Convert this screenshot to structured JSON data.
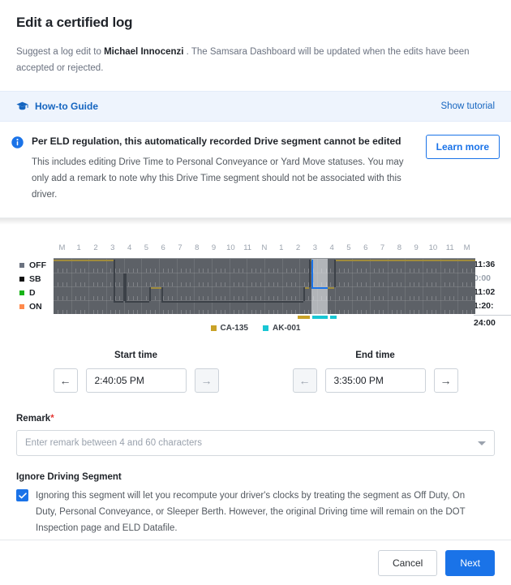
{
  "header": {
    "title": "Edit a certified log",
    "subtitle_pre": "Suggest a log edit to ",
    "driver_name": "Michael Innocenzi",
    "subtitle_post": " . The Samsara Dashboard will be updated when the edits have been accepted or rejected."
  },
  "howto": {
    "icon": "graduation-cap-icon",
    "label": "How-to Guide",
    "tutorial_link": "Show tutorial"
  },
  "notice": {
    "icon": "info-circle-icon",
    "title": "Per ELD regulation, this automatically recorded Drive segment cannot be edited",
    "body": "This includes editing Drive Time to Personal Conveyance or Yard Move statuses. You may only add a remark to note why this Drive Time segment should not be associated with this driver.",
    "learn_more": "Learn more",
    "accent_color": "#1a73e8"
  },
  "chart_data": {
    "type": "line",
    "title": "",
    "xlabel": "",
    "ylabel": "",
    "hour_labels": [
      "M",
      "1",
      "2",
      "3",
      "4",
      "5",
      "6",
      "7",
      "8",
      "9",
      "10",
      "11",
      "N",
      "1",
      "2",
      "3",
      "4",
      "5",
      "6",
      "7",
      "8",
      "9",
      "10",
      "11",
      "M"
    ],
    "statuses": [
      {
        "code": "OFF",
        "color": "#6b7280",
        "total": "11:36"
      },
      {
        "code": "SB",
        "color": "#111111",
        "total": "0:00"
      },
      {
        "code": "D",
        "color": "#17b317",
        "total": "11:02"
      },
      {
        "code": "ON",
        "color": "#ff8a4c",
        "total": "1:20:"
      }
    ],
    "grand_total": "24:00",
    "vehicle_legend": [
      {
        "label": "CA-135",
        "color": "#c9a227"
      },
      {
        "label": "AK-001",
        "color": "#19c6d4"
      }
    ],
    "selected_segment": {
      "start_hour": 14.67,
      "end_hour": 15.58,
      "status": "D",
      "color": "#1a73e8"
    },
    "duty_segments": [
      {
        "status": "OFF",
        "start_hour": 0.0,
        "end_hour": 3.4
      },
      {
        "status": "ON",
        "start_hour": 3.4,
        "end_hour": 3.95
      },
      {
        "status": "SB",
        "start_hour": 3.95,
        "end_hour": 4.05
      },
      {
        "status": "ON",
        "start_hour": 4.05,
        "end_hour": 5.45
      },
      {
        "status": "D",
        "start_hour": 5.45,
        "end_hour": 6.15
      },
      {
        "status": "ON",
        "start_hour": 6.15,
        "end_hour": 14.2
      },
      {
        "status": "D",
        "start_hour": 14.2,
        "end_hour": 14.55
      },
      {
        "status": "OFF",
        "start_hour": 14.55,
        "end_hour": 14.67
      },
      {
        "status": "D",
        "start_hour": 14.67,
        "end_hour": 15.58
      },
      {
        "status": "D",
        "start_hour": 15.58,
        "end_hour": 15.95
      },
      {
        "status": "OFF",
        "start_hour": 15.95,
        "end_hour": 24.0
      }
    ],
    "vehicle_bars": [
      {
        "vehicle": "CA-135",
        "start_hour": 13.9,
        "end_hour": 14.6
      },
      {
        "vehicle": "AK-001",
        "start_hour": 14.7,
        "end_hour": 15.6
      },
      {
        "vehicle": "AK-001",
        "start_hour": 15.75,
        "end_hour": 16.1
      }
    ]
  },
  "start_time": {
    "label": "Start time",
    "value": "2:40:05 PM",
    "prev_icon": "arrow-left-icon",
    "next_icon": "arrow-right-icon"
  },
  "end_time": {
    "label": "End time",
    "value": "3:35:00 PM",
    "prev_icon": "arrow-left-icon",
    "next_icon": "arrow-right-icon"
  },
  "remark": {
    "label": "Remark",
    "required_marker": "*",
    "value": "",
    "placeholder": "Enter remark between 4 and 60 characters",
    "dropdown_icon": "chevron-down-icon"
  },
  "ignore_segment": {
    "title": "Ignore Driving Segment",
    "checked": true,
    "checkbox_color": "#1a73e8",
    "description": "Ignoring this segment will let you recompute your driver's clocks by treating the segment as Off Duty, On Duty, Personal Conveyance, or Sleeper Berth. However, the original Driving time will remain on the DOT Inspection page and ELD Datafile."
  },
  "footer": {
    "cancel_label": "Cancel",
    "next_label": "Next"
  }
}
